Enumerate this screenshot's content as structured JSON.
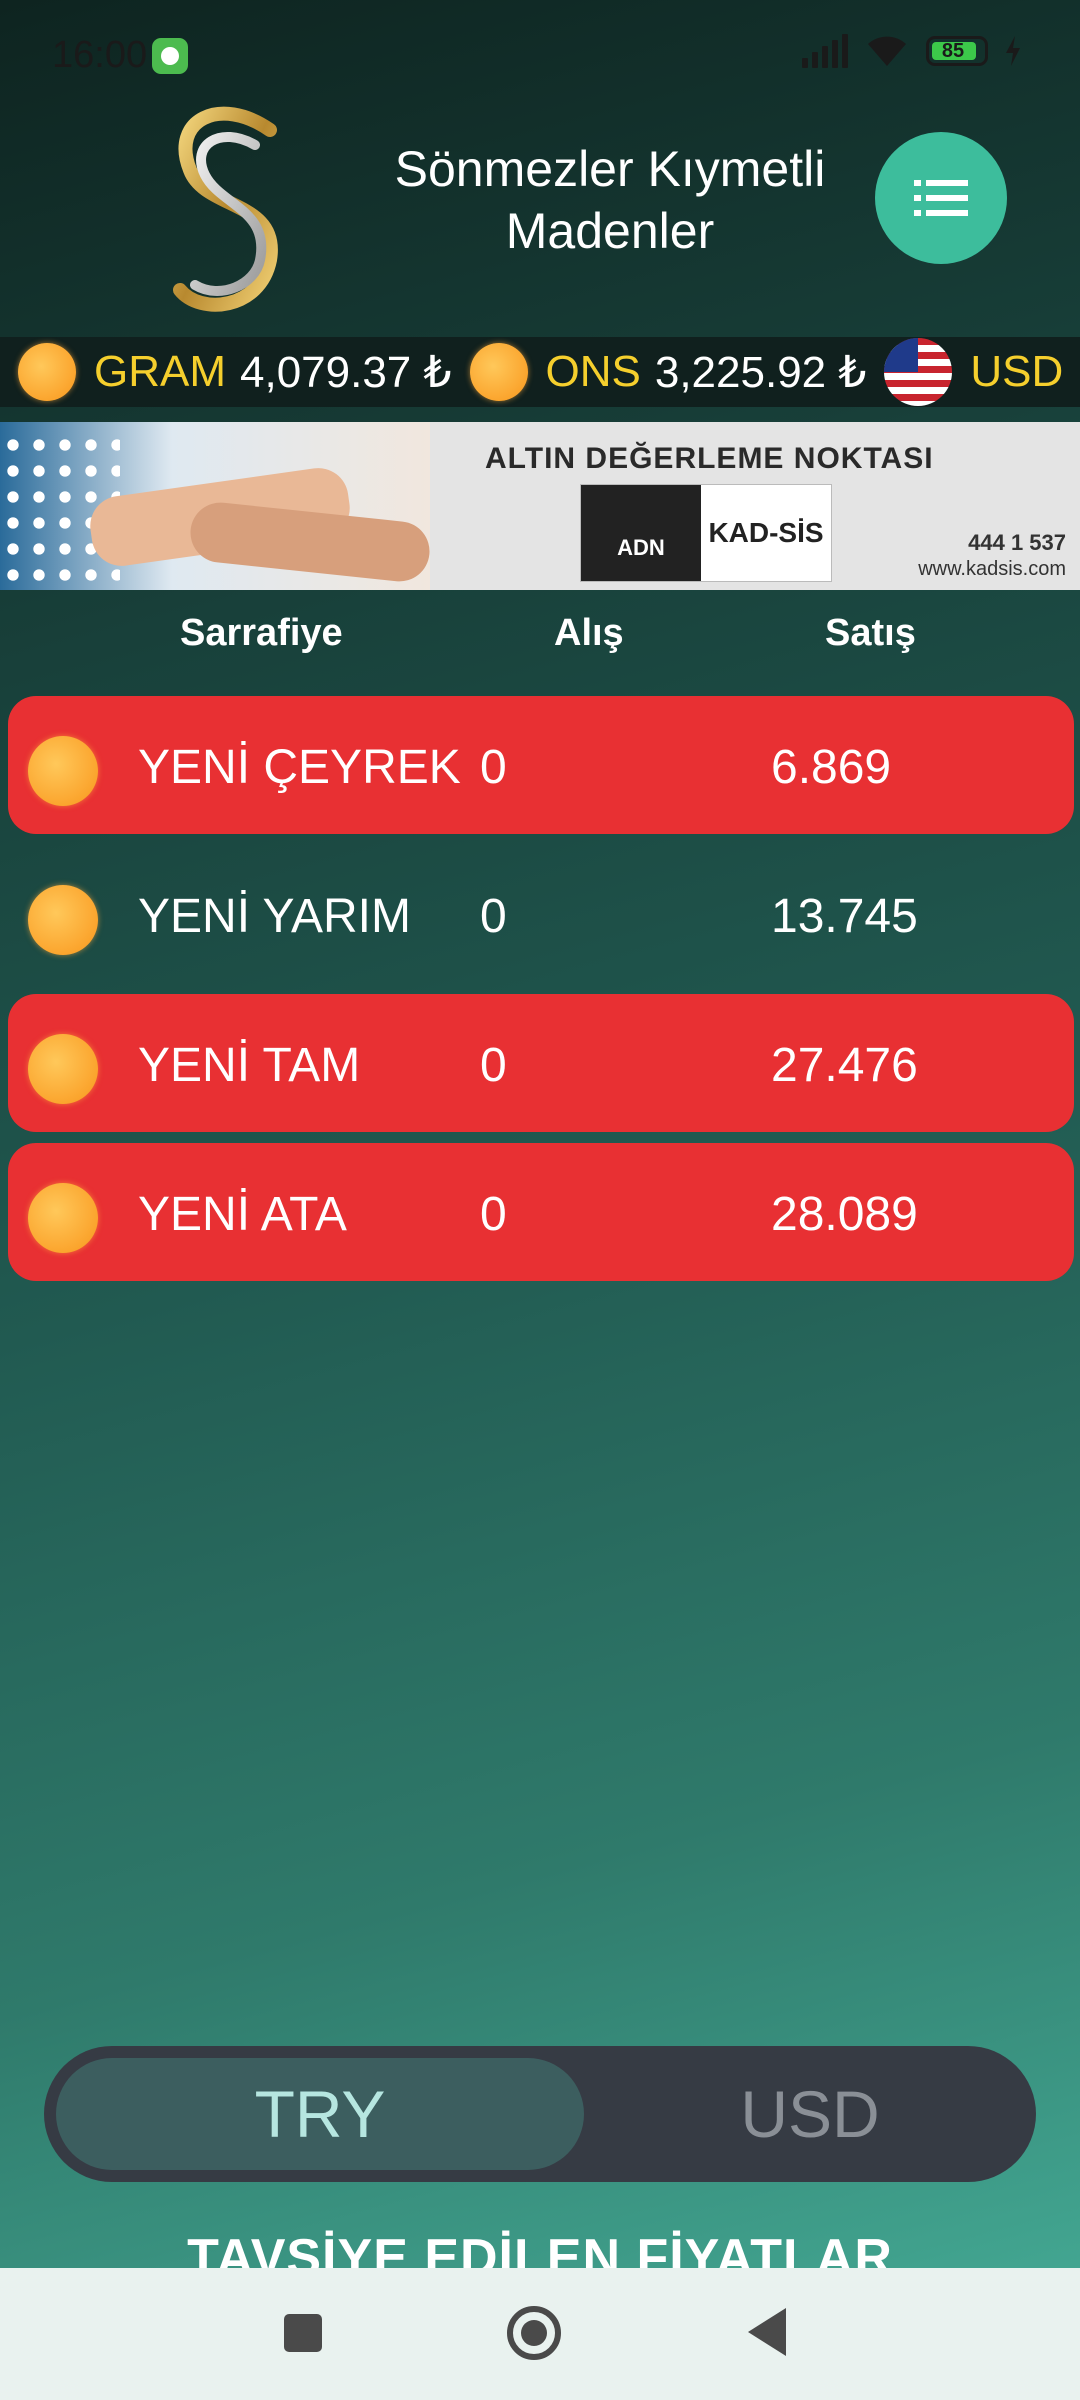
{
  "status_bar": {
    "time": "16:00",
    "battery": "85"
  },
  "header": {
    "title": "Sönmezler Kıymetli Madenler"
  },
  "ticker": [
    {
      "label": "GRAM",
      "value": "4,079.37 ₺",
      "icon": "gold-coin"
    },
    {
      "label": "ONS",
      "value": "3,225.92 ₺",
      "icon": "gold-coin"
    },
    {
      "label": "USD",
      "value": "",
      "icon": "us-flag"
    }
  ],
  "banner": {
    "title": "ALTIN DEĞERLEME NOKTASI",
    "logo_left": "ADN",
    "logo_right": "KAD-SİS",
    "phone": "444 1 537",
    "website": "www.kadsis.com"
  },
  "table": {
    "headers": {
      "name": "Sarrafiye",
      "buy": "Alış",
      "sell": "Satış"
    },
    "rows": [
      {
        "name": "YENİ ÇEYREK",
        "buy": "0",
        "sell": "6.869",
        "highlight": true
      },
      {
        "name": "YENİ YARIM",
        "buy": "0",
        "sell": "13.745",
        "highlight": false
      },
      {
        "name": "YENİ TAM",
        "buy": "0",
        "sell": "27.476",
        "highlight": true
      },
      {
        "name": "YENİ ATA",
        "buy": "0",
        "sell": "28.089",
        "highlight": true
      }
    ]
  },
  "currency_toggle": {
    "options": [
      "TRY",
      "USD"
    ],
    "selected": "TRY"
  },
  "footer": {
    "title": "TAVSİYE EDİLEN FİYATLAR"
  },
  "colors": {
    "highlight_row": "#e83033",
    "accent": "#3dbd9c",
    "ticker_label": "#f5cf2d"
  }
}
